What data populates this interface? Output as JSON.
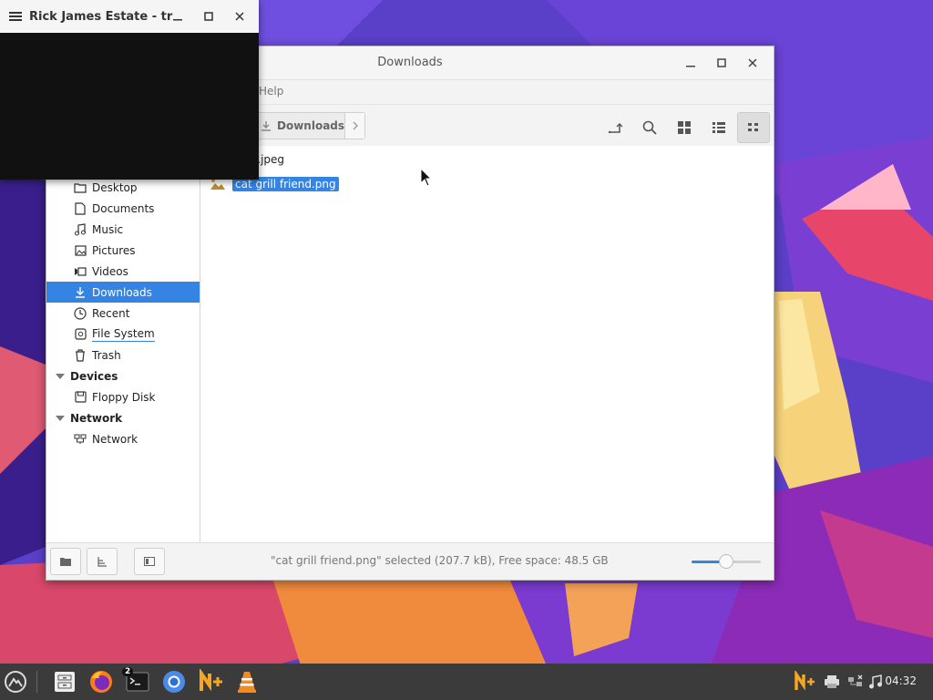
{
  "colors": {
    "accent": "#3584e4",
    "taskbar": "#3b3b3b"
  },
  "overlay_window": {
    "title": "Rick James Estate - tr",
    "ghost_line1": "",
    "ghost_line2": ""
  },
  "file_manager": {
    "title": "Downloads",
    "menu": {
      "help": "Help"
    },
    "breadcrumb": {
      "current": "Downloads"
    },
    "toolbar_icons": [
      "new-folder-icon",
      "search-icon",
      "grid-view-icon",
      "list-view-icon",
      "compact-view-icon"
    ],
    "sidebar": {
      "places": [
        {
          "label": "Desktop",
          "icon": "folder-icon"
        },
        {
          "label": "Documents",
          "icon": "document-icon"
        },
        {
          "label": "Music",
          "icon": "music-icon"
        },
        {
          "label": "Pictures",
          "icon": "picture-icon"
        },
        {
          "label": "Videos",
          "icon": "video-icon"
        },
        {
          "label": "Downloads",
          "icon": "download-icon",
          "selected": true
        },
        {
          "label": "Recent",
          "icon": "clock-icon"
        },
        {
          "label": "File System",
          "icon": "drive-icon"
        },
        {
          "label": "Trash",
          "icon": "trash-icon"
        }
      ],
      "devices_header": "Devices",
      "devices": [
        {
          "label": "Floppy Disk",
          "icon": "floppy-icon"
        }
      ],
      "network_header": "Network",
      "network": [
        {
          "label": "Network",
          "icon": "network-icon"
        }
      ]
    },
    "files": [
      {
        "name": "ges.jpeg",
        "selected": false
      },
      {
        "name": "cat grill friend.png",
        "selected": true
      }
    ],
    "status": "\"cat grill friend.png\" selected (207.7 kB), Free space: 48.5 GB",
    "zoom_level": 0.5
  },
  "taskbar": {
    "apps": [
      "menu-icon",
      "file-manager-icon",
      "firefox-icon",
      "terminal-icon",
      "chromium-icon",
      "notepadqq-icon",
      "vlc-icon"
    ],
    "terminal_badge": "2",
    "tray": [
      "notepadqq-tray-icon",
      "printer-icon",
      "network-disconnected-icon",
      "music-icon"
    ],
    "clock": "04:32"
  }
}
